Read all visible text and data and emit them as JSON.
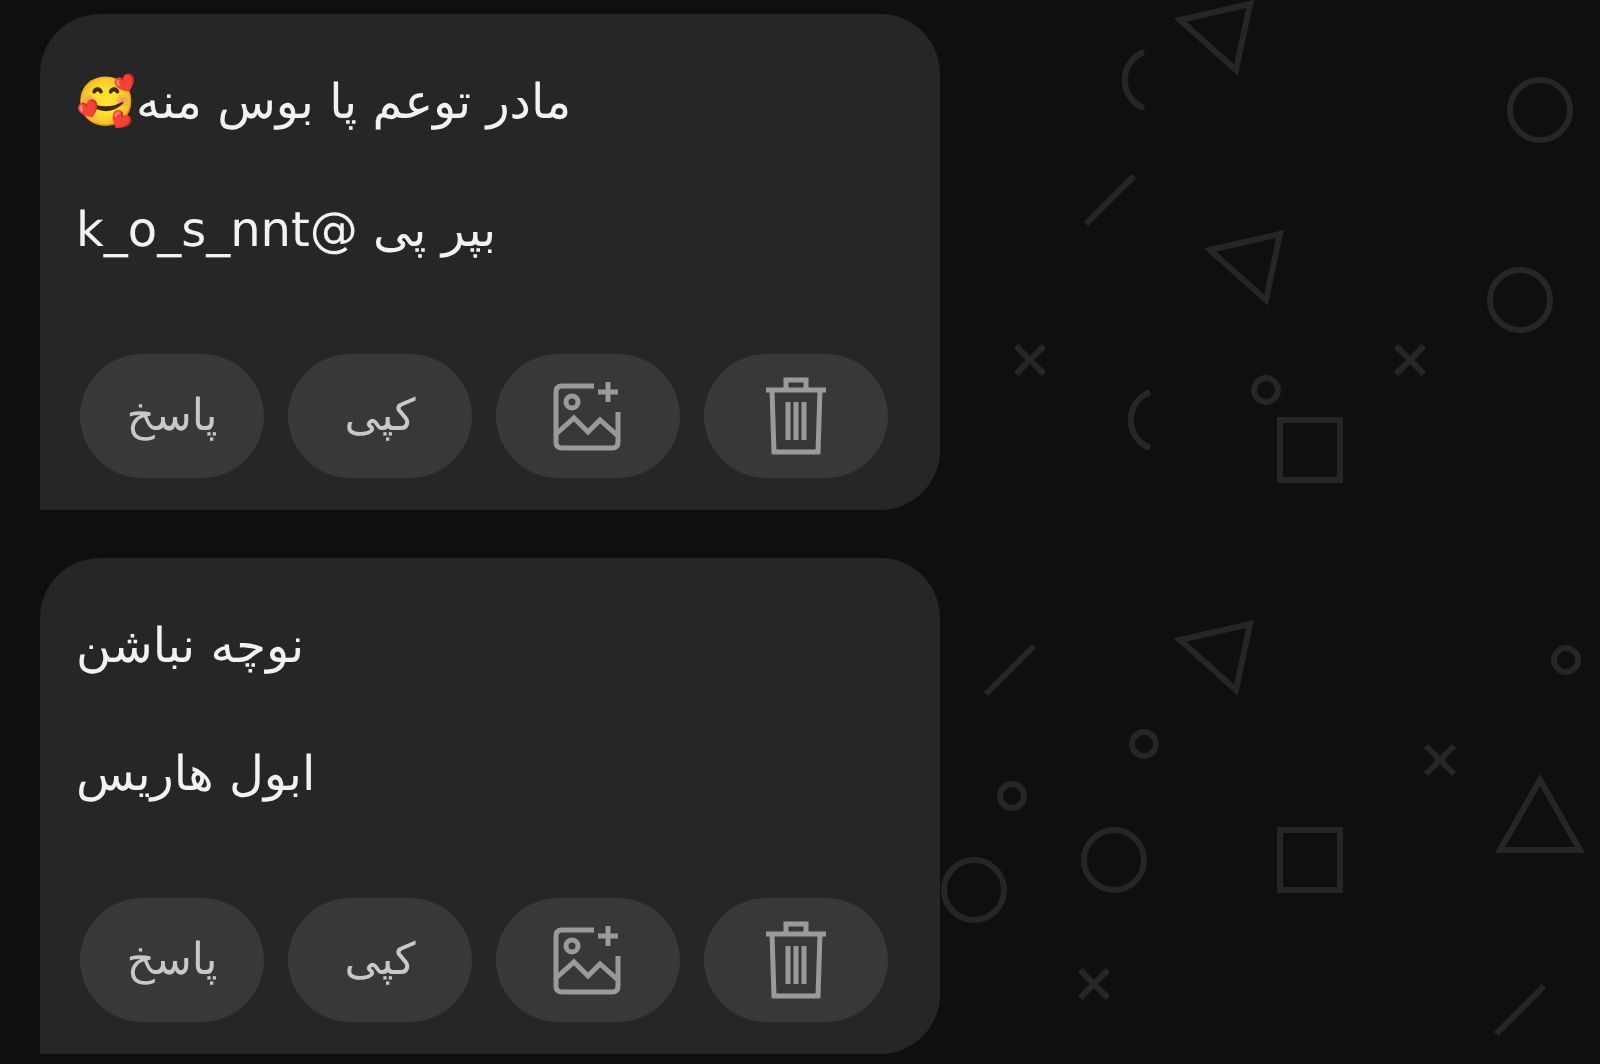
{
  "messages": [
    {
      "lines": [
        "مادر توعم پا بوس منه🥰",
        "بپر پی @k_o_s_nnt"
      ],
      "actions": [
        {
          "kind": "delete"
        },
        {
          "kind": "add-image"
        },
        {
          "kind": "text",
          "label": "کپی"
        },
        {
          "kind": "text",
          "label": "پاسخ"
        }
      ]
    },
    {
      "lines": [
        "نوچه نباشن",
        "ابول هاریس"
      ],
      "actions": [
        {
          "kind": "delete"
        },
        {
          "kind": "add-image"
        },
        {
          "kind": "text",
          "label": "کپی"
        },
        {
          "kind": "text",
          "label": "پاسخ"
        }
      ]
    }
  ]
}
